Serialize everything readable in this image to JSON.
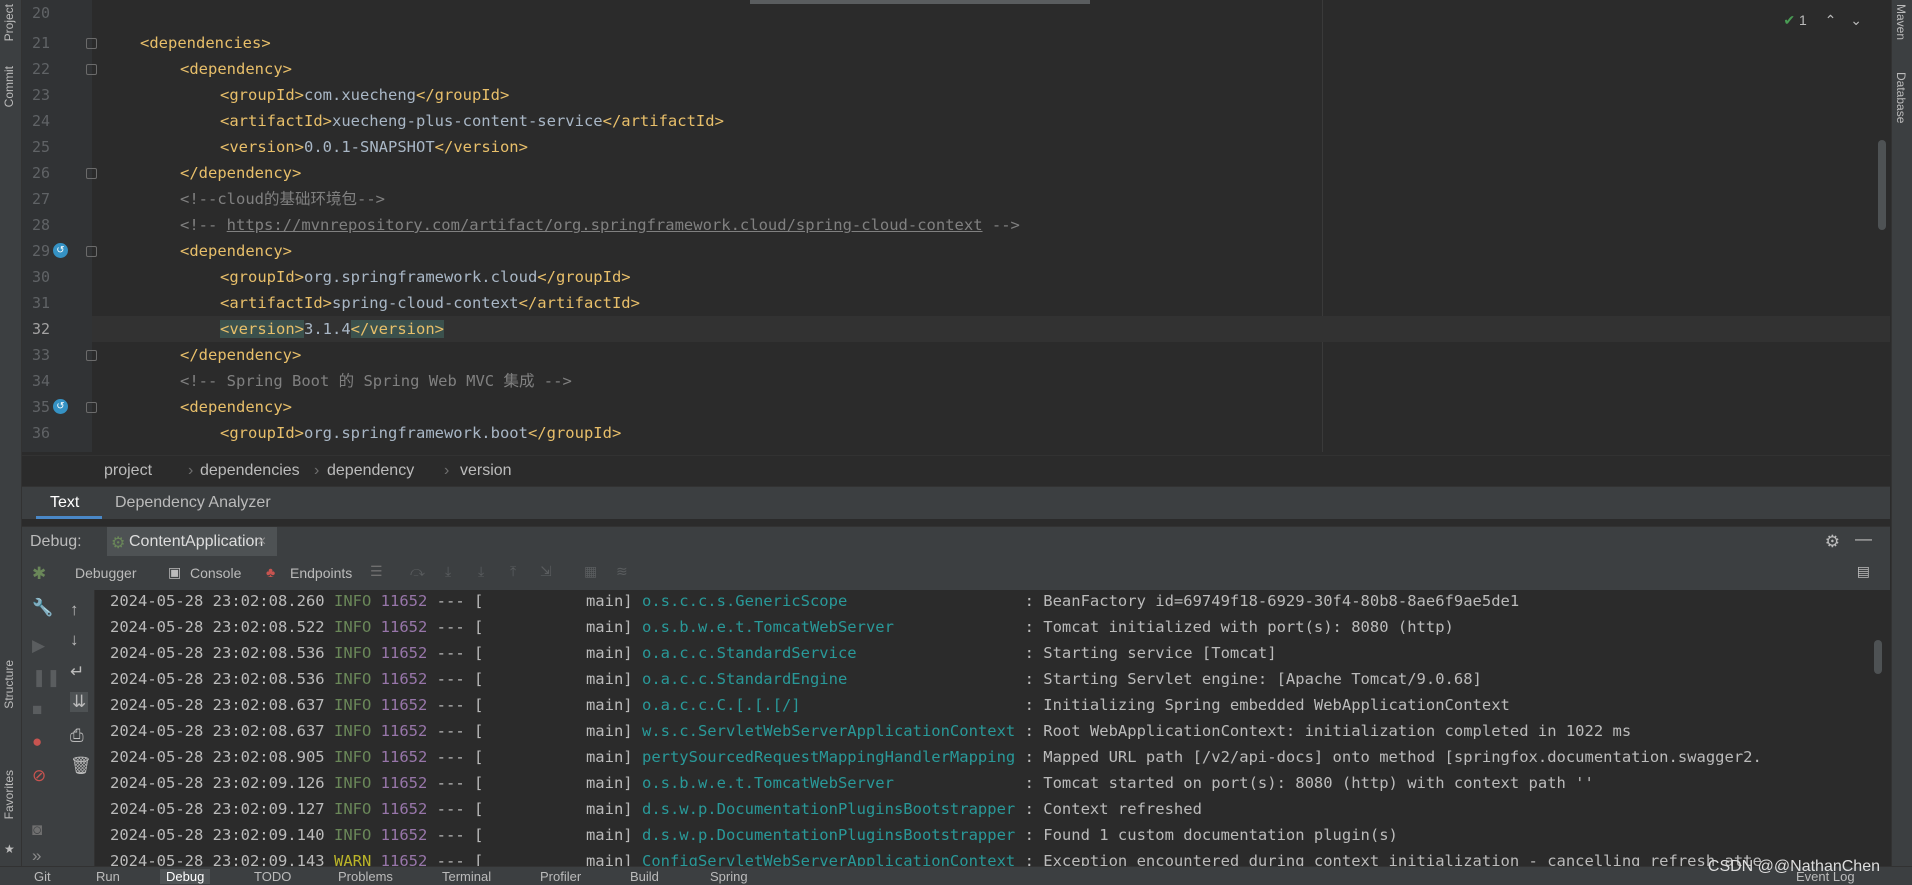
{
  "left_toolwindows": [
    "Project",
    "Commit",
    "Structure",
    "Favorites"
  ],
  "right_toolwindows": [
    "Maven",
    "Database"
  ],
  "editor": {
    "inspection_count": "1",
    "lines": [
      {
        "num": "20",
        "text": ""
      },
      {
        "num": "21",
        "text": "<dependencies>"
      },
      {
        "num": "22",
        "text": "<dependency>"
      },
      {
        "num": "23",
        "open": "<groupId>",
        "content": "com.xuecheng",
        "close": "</groupId>"
      },
      {
        "num": "24",
        "open": "<artifactId>",
        "content": "xuecheng-plus-content-service",
        "close": "</artifactId>"
      },
      {
        "num": "25",
        "open": "<version>",
        "content": "0.0.1-SNAPSHOT",
        "close": "</version>"
      },
      {
        "num": "26",
        "text": "</dependency>"
      },
      {
        "num": "27",
        "comment": "<!--cloud的基础环境包-->"
      },
      {
        "num": "28",
        "comment_open": "<!-- ",
        "url": "https://mvnrepository.com/artifact/org.springframework.cloud/spring-cloud-context",
        "comment_close": " -->"
      },
      {
        "num": "29",
        "text": "<dependency>"
      },
      {
        "num": "30",
        "open": "<groupId>",
        "content": "org.springframework.cloud",
        "close": "</groupId>"
      },
      {
        "num": "31",
        "open": "<artifactId>",
        "content": "spring-cloud-context",
        "close": "</artifactId>"
      },
      {
        "num": "32",
        "open": "<version>",
        "content": "3.1.4",
        "close": "</version>"
      },
      {
        "num": "33",
        "text": "</dependency>"
      },
      {
        "num": "34",
        "comment": "<!-- Spring Boot 的 Spring Web MVC 集成 -->"
      },
      {
        "num": "35",
        "text": "<dependency>"
      },
      {
        "num": "36",
        "open": "<groupId>",
        "content": "org.springframework.boot",
        "close": "</groupId>"
      }
    ]
  },
  "breadcrumb": [
    "project",
    "dependencies",
    "dependency",
    "version"
  ],
  "editor_tabs": [
    "Text",
    "Dependency Analyzer"
  ],
  "debug": {
    "label": "Debug:",
    "config": "ContentApplication",
    "tabs": [
      "Debugger",
      "Console",
      "Endpoints"
    ]
  },
  "console_lines": [
    {
      "ts": "2024-05-28 23:02:08.260",
      "lvl": "INFO",
      "pid": "11652",
      "thread": "--- [           main]",
      "logger": "o.s.c.c.s.GenericScope                  ",
      "msg": ": BeanFactory id=69749f18-6929-30f4-80b8-8ae6f9ae5de1"
    },
    {
      "ts": "2024-05-28 23:02:08.522",
      "lvl": "INFO",
      "pid": "11652",
      "thread": "--- [           main]",
      "logger": "o.s.b.w.e.t.TomcatWebServer             ",
      "msg": ": Tomcat initialized with port(s): 8080 (http)"
    },
    {
      "ts": "2024-05-28 23:02:08.536",
      "lvl": "INFO",
      "pid": "11652",
      "thread": "--- [           main]",
      "logger": "o.a.c.c.StandardService                 ",
      "msg": ": Starting service [Tomcat]"
    },
    {
      "ts": "2024-05-28 23:02:08.536",
      "lvl": "INFO",
      "pid": "11652",
      "thread": "--- [           main]",
      "logger": "o.a.c.c.StandardEngine                  ",
      "msg": ": Starting Servlet engine: [Apache Tomcat/9.0.68]"
    },
    {
      "ts": "2024-05-28 23:02:08.637",
      "lvl": "INFO",
      "pid": "11652",
      "thread": "--- [           main]",
      "logger": "o.a.c.c.C.[.[.[/]                       ",
      "msg": ": Initializing Spring embedded WebApplicationContext"
    },
    {
      "ts": "2024-05-28 23:02:08.637",
      "lvl": "INFO",
      "pid": "11652",
      "thread": "--- [           main]",
      "logger": "w.s.c.ServletWebServerApplicationContext",
      "msg": ": Root WebApplicationContext: initialization completed in 1022 ms"
    },
    {
      "ts": "2024-05-28 23:02:08.905",
      "lvl": "INFO",
      "pid": "11652",
      "thread": "--- [           main]",
      "logger": "pertySourcedRequestMappingHandlerMapping",
      "msg": ": Mapped URL path [/v2/api-docs] onto method [springfox.documentation.swagger2."
    },
    {
      "ts": "2024-05-28 23:02:09.126",
      "lvl": "INFO",
      "pid": "11652",
      "thread": "--- [           main]",
      "logger": "o.s.b.w.e.t.TomcatWebServer             ",
      "msg": ": Tomcat started on port(s): 8080 (http) with context path ''"
    },
    {
      "ts": "2024-05-28 23:02:09.127",
      "lvl": "INFO",
      "pid": "11652",
      "thread": "--- [           main]",
      "logger": "d.s.w.p.DocumentationPluginsBootstrapper",
      "msg": ": Context refreshed"
    },
    {
      "ts": "2024-05-28 23:02:09.140",
      "lvl": "INFO",
      "pid": "11652",
      "thread": "--- [           main]",
      "logger": "d.s.w.p.DocumentationPluginsBootstrapper",
      "msg": ": Found 1 custom documentation plugin(s)"
    },
    {
      "ts": "2024-05-28 23:02:09.143",
      "lvl": "WARN",
      "pid": "11652",
      "thread": "--- [           main]",
      "logger": "ConfigServletWebServerApplicationContext",
      "msg": ": Exception encountered during context initialization - cancelling refresh atte"
    }
  ],
  "status_bar": [
    "Git",
    "Run",
    "Debug",
    "TODO",
    "Problems",
    "Terminal",
    "Profiler",
    "Build",
    "Spring",
    "Event Log"
  ],
  "watermark": "CSDN @@NathanChen"
}
